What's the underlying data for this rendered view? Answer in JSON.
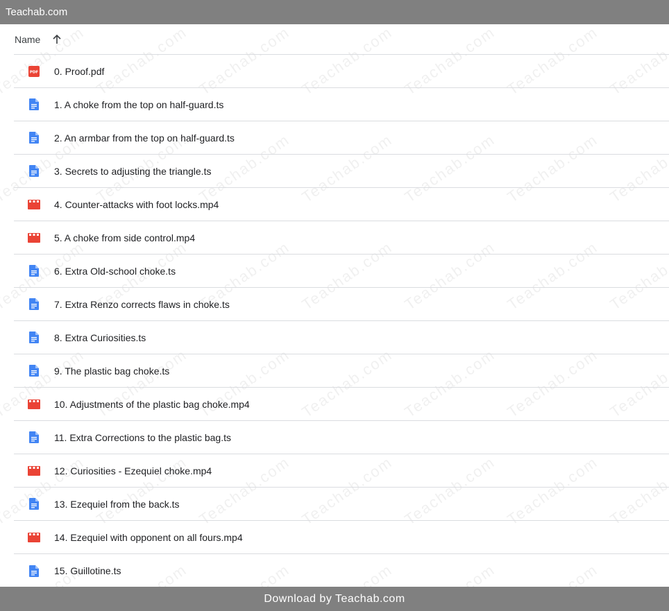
{
  "site": {
    "title": "Teachab.com"
  },
  "list_header": {
    "name_label": "Name",
    "sort_icon": "arrow-up-icon"
  },
  "files": [
    {
      "name": "0. Proof.pdf",
      "type": "pdf"
    },
    {
      "name": "1. A choke from the top on half-guard.ts",
      "type": "doc"
    },
    {
      "name": "2. An armbar from the top on half-guard.ts",
      "type": "doc"
    },
    {
      "name": "3. Secrets to adjusting the triangle.ts",
      "type": "doc"
    },
    {
      "name": "4. Counter-attacks with foot locks.mp4",
      "type": "video"
    },
    {
      "name": "5. A choke from side control.mp4",
      "type": "video"
    },
    {
      "name": "6. Extra Old-school choke.ts",
      "type": "doc"
    },
    {
      "name": "7. Extra Renzo corrects flaws in choke.ts",
      "type": "doc"
    },
    {
      "name": "8. Extra Curiosities.ts",
      "type": "doc"
    },
    {
      "name": "9. The plastic bag choke.ts",
      "type": "doc"
    },
    {
      "name": "10. Adjustments of the plastic bag choke.mp4",
      "type": "video"
    },
    {
      "name": "11. Extra Corrections to the plastic bag.ts",
      "type": "doc"
    },
    {
      "name": "12. Curiosities - Ezequiel choke.mp4",
      "type": "video"
    },
    {
      "name": "13. Ezequiel from the back.ts",
      "type": "doc"
    },
    {
      "name": "14. Ezequiel with opponent on all fours.mp4",
      "type": "video"
    },
    {
      "name": "15. Guillotine.ts",
      "type": "doc"
    }
  ],
  "watermark": {
    "text": "Teachab.com"
  },
  "footer": {
    "download_label": "Download by Teachab.com"
  },
  "colors": {
    "bar": "#808080",
    "doc_icon": "#4285f4",
    "pdf_icon": "#ea4335",
    "video_icon": "#ea4335",
    "divider": "#dadce0"
  }
}
